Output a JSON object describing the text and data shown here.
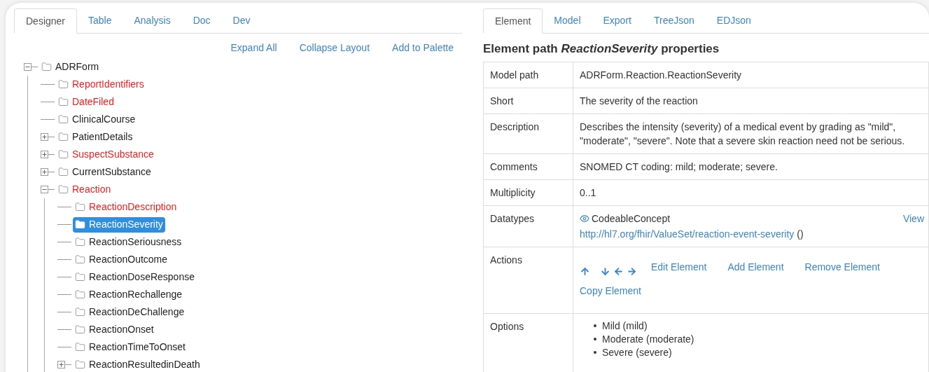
{
  "left_tabs": [
    {
      "label": "Designer",
      "selected": true
    },
    {
      "label": "Table",
      "selected": false
    },
    {
      "label": "Analysis",
      "selected": false
    },
    {
      "label": "Doc",
      "selected": false
    },
    {
      "label": "Dev",
      "selected": false
    }
  ],
  "tree_actions": [
    "Expand All",
    "Collapse Layout",
    "Add to Palette"
  ],
  "tree": [
    {
      "label": "ADRForm",
      "kind": "branch",
      "expanded": true,
      "required": false,
      "selected": false,
      "children": [
        {
          "label": "ReportIdentifiers",
          "kind": "leaf",
          "required": true,
          "selected": false
        },
        {
          "label": "DateFiled",
          "kind": "leaf",
          "required": true,
          "selected": false
        },
        {
          "label": "ClinicalCourse",
          "kind": "leaf",
          "required": false,
          "selected": false
        },
        {
          "label": "PatientDetails",
          "kind": "branch",
          "expanded": false,
          "required": false,
          "selected": false
        },
        {
          "label": "SuspectSubstance",
          "kind": "branch",
          "expanded": false,
          "required": true,
          "selected": false
        },
        {
          "label": "CurrentSubstance",
          "kind": "branch",
          "expanded": false,
          "required": false,
          "selected": false
        },
        {
          "label": "Reaction",
          "kind": "branch",
          "expanded": true,
          "required": true,
          "selected": false,
          "children": [
            {
              "label": "ReactionDescription",
              "kind": "leaf",
              "required": true,
              "selected": false
            },
            {
              "label": "ReactionSeverity",
              "kind": "leaf",
              "required": false,
              "selected": true
            },
            {
              "label": "ReactionSeriousness",
              "kind": "leaf",
              "required": false,
              "selected": false
            },
            {
              "label": "ReactionOutcome",
              "kind": "leaf",
              "required": false,
              "selected": false
            },
            {
              "label": "ReactionDoseResponse",
              "kind": "leaf",
              "required": false,
              "selected": false
            },
            {
              "label": "ReactionRechallenge",
              "kind": "leaf",
              "required": false,
              "selected": false
            },
            {
              "label": "ReactionDeChallenge",
              "kind": "leaf",
              "required": false,
              "selected": false
            },
            {
              "label": "ReactionOnset",
              "kind": "leaf",
              "required": false,
              "selected": false
            },
            {
              "label": "ReactionTimeToOnset",
              "kind": "leaf",
              "required": false,
              "selected": false
            },
            {
              "label": "ReactionResultedinDeath",
              "kind": "branch",
              "expanded": false,
              "required": false,
              "selected": false
            }
          ]
        }
      ]
    }
  ],
  "right_tabs": [
    {
      "label": "Element",
      "selected": true
    },
    {
      "label": "Model",
      "selected": false
    },
    {
      "label": "Export",
      "selected": false
    },
    {
      "label": "TreeJson",
      "selected": false
    },
    {
      "label": "EDJson",
      "selected": false
    }
  ],
  "heading": "Element path *ReactionSeverity* properties",
  "properties": [
    {
      "label": "Model path",
      "kind": "text",
      "value": "ADRForm.Reaction.ReactionSeverity"
    },
    {
      "label": "Short",
      "kind": "text",
      "value": "The severity of the reaction"
    },
    {
      "label": "Description",
      "kind": "text",
      "value": "Describes the intensity (severity) of a medical event by grading as \"mild\", \"moderate\", \"severe\". Note that a severe skin reaction need not be serious."
    },
    {
      "label": "Comments",
      "kind": "text",
      "value": "SNOMED CT coding: mild; moderate; severe."
    },
    {
      "label": "Multiplicity",
      "kind": "text",
      "value": "0..1"
    },
    {
      "label": "Datatypes",
      "kind": "datatype",
      "type": "CodeableConcept",
      "link": "http://hl7.org/fhir/ValueSet/reaction-event-severity",
      "suffix": "()",
      "view": "View"
    },
    {
      "label": "Actions",
      "kind": "actions",
      "actions": [
        "Edit Element",
        "Add Element",
        "Remove Element",
        "Copy Element"
      ]
    },
    {
      "label": "Options",
      "kind": "options",
      "options": [
        "Mild (mild)",
        "Moderate (moderate)",
        "Severe (severe)"
      ]
    }
  ]
}
